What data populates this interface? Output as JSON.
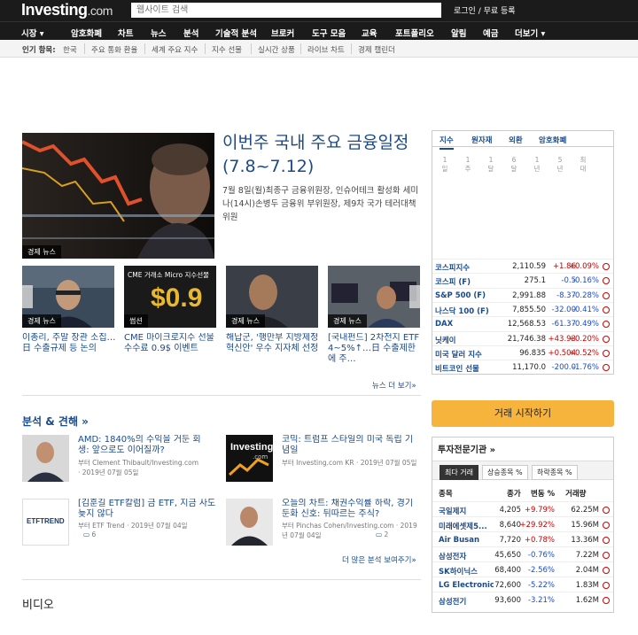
{
  "brand": {
    "logo_main": "Investing",
    "logo_suffix": ".com"
  },
  "search": {
    "placeholder": "웹사이트 검색"
  },
  "login": {
    "label": "로그인 / 무료 등록"
  },
  "nav": {
    "items": [
      "시장 ▾",
      "암호화폐",
      "차트",
      "뉴스",
      "분석",
      "기술적 분석",
      "브로커",
      "도구 모음",
      "교육",
      "포트폴리오",
      "알림",
      "예금",
      "더보기 ▾"
    ]
  },
  "popular": {
    "label": "인기 항목:",
    "items": [
      "한국",
      "주요 통화 환율",
      "세계 주요 지수",
      "지수 선물",
      "실시간 상품",
      "라이브 차트",
      "경제 캘린더"
    ]
  },
  "hero": {
    "title": "이번주 국내 주요 금융일정(7.8~7.12)",
    "desc": "7월 8일(월)최종구 금융위원장, 인슈어테크 활성화 세미나(14시)손병두 금융위 부위원장, 제9차 국가 테러대책위원",
    "tag": "경제 뉴스"
  },
  "thumbs": [
    {
      "tag": "경제 뉴스",
      "title": "이총리, 주말 장관 소집…日 수출규제 등 논의"
    },
    {
      "tag": "썹션",
      "title": "CME 마이크로지수 선물 수수료 0.9$ 이벤트"
    },
    {
      "tag": "경제 뉴스",
      "title": "해납군, '행만부 지방제정 혁신안' 우수 지자체 선정"
    },
    {
      "tag": "경제 뉴스",
      "title": "[국내펀드] 2차전지 ETF 4~5%↑…日 수출제한에 주…"
    }
  ],
  "cme_banner": {
    "line1": "CME 거래소 Micro 지수선물",
    "line2": "$0.9"
  },
  "news_more": "뉴스 더 보기»",
  "analysis": {
    "heading": "분석 & 견해 »",
    "items": [
      {
        "title": "AMD: 1840%의 수익을 거둔 회생: 앞으로도 이어질까?",
        "meta": "부터 Clement Thibault/Investing.com · 2019년 07월 05일",
        "comments": ""
      },
      {
        "title": "코믹: 트럼프 스타일의 미국 독립 기념일",
        "meta": "부터 Investing.com KR · 2019년 07월 05일",
        "comments": ""
      },
      {
        "title": "[김훈길 ETF칼럼] 금 ETF, 지금 사도 늦지 않다",
        "meta": "부터 ETF Trend · 2019년 07월 04일",
        "comments": "6"
      },
      {
        "title": "오늘의 차트: 채권수익률 하락, 경기 둔화 신호: 뒤따르는 주식?",
        "meta": "부터 Pinchas Cohen/Investing.com · 2019년 07월 04일",
        "comments": "2"
      }
    ],
    "more": "더 많은 분석 보여주기»",
    "logo_investing": "Investing",
    "logo_investing_suffix": ".com",
    "logo_etf": "ETFTREND"
  },
  "video": {
    "heading": "비디오"
  },
  "indices": {
    "tabs": [
      "지수",
      "원자재",
      "외환",
      "암호화폐"
    ],
    "timeframes": [
      "1 일",
      "1 주",
      "1 달",
      "6 달",
      "1 년",
      "5 년",
      "최 대"
    ],
    "rows": [
      {
        "name": "코스피지수",
        "value": "2,110.59",
        "change": "+1.86",
        "pct": "+0.09%",
        "dir": "pos"
      },
      {
        "name": "코스피 (F)",
        "value": "275.1",
        "change": "-0.5",
        "pct": "-0.16%",
        "dir": "neg"
      },
      {
        "name": "S&P 500 (F)",
        "value": "2,991.88",
        "change": "-8.37",
        "pct": "-0.28%",
        "dir": "neg"
      },
      {
        "name": "나스닥 100 (F)",
        "value": "7,855.50",
        "change": "-32.00",
        "pct": "-0.41%",
        "dir": "neg"
      },
      {
        "name": "DAX",
        "value": "12,568.53",
        "change": "-61.37",
        "pct": "-0.49%",
        "dir": "neg"
      },
      {
        "name": "닛케이",
        "value": "21,746.38",
        "change": "+43.93",
        "pct": "+0.20%",
        "dir": "pos"
      },
      {
        "name": "미국 달러 지수",
        "value": "96.835",
        "change": "+0.504",
        "pct": "+0.52%",
        "dir": "pos"
      },
      {
        "name": "비트코인 선물",
        "value": "11,170.0",
        "change": "-200.0",
        "pct": "-1.76%",
        "dir": "neg"
      }
    ]
  },
  "trade_button": "거래 시작하기",
  "investors": {
    "title": "투자전문기관 »",
    "tabs": [
      "최다 거래",
      "상승종목 %",
      "하락종목 %"
    ],
    "headers": [
      "종목",
      "종가",
      "변동 %",
      "거래량"
    ],
    "rows": [
      {
        "name": "국일제지",
        "price": "4,205",
        "pct": "+9.79%",
        "vol": "62.25M",
        "dir": "pos"
      },
      {
        "name": "미래에셋제5...",
        "price": "8,640",
        "pct": "+29.92%",
        "vol": "15.96M",
        "dir": "pos"
      },
      {
        "name": "Air Busan",
        "price": "7,720",
        "pct": "+0.78%",
        "vol": "13.36M",
        "dir": "pos"
      },
      {
        "name": "삼성전자",
        "price": "45,650",
        "pct": "-0.76%",
        "vol": "7.22M",
        "dir": "neg"
      },
      {
        "name": "SK하이닉스",
        "price": "68,400",
        "pct": "-2.56%",
        "vol": "2.04M",
        "dir": "neg"
      },
      {
        "name": "LG Electronics",
        "price": "72,600",
        "pct": "-5.22%",
        "vol": "1.83M",
        "dir": "neg"
      },
      {
        "name": "삼성전기",
        "price": "93,600",
        "pct": "-3.21%",
        "vol": "1.62M",
        "dir": "neg"
      }
    ]
  }
}
